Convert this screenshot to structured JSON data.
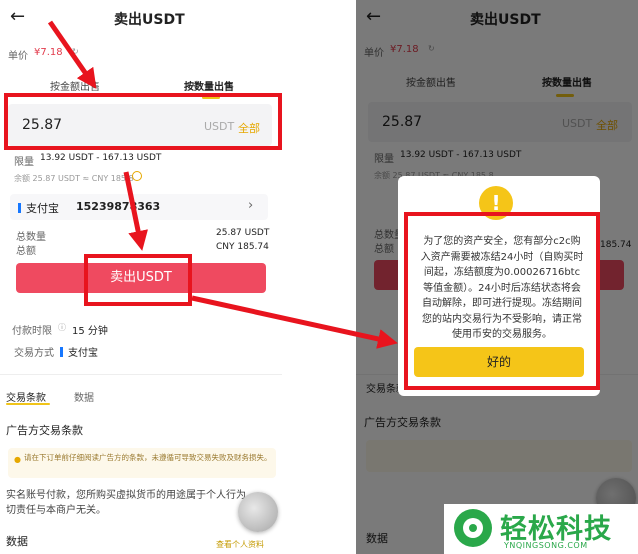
{
  "left": {
    "header": {
      "back": "←",
      "title": "卖出USDT"
    },
    "price": {
      "label": "单价",
      "value": "¥7.18"
    },
    "tabs": [
      {
        "label": "按金额出售"
      },
      {
        "label": "按数量出售"
      }
    ],
    "amount": {
      "value": "25.87",
      "unit": "USDT",
      "all": "全部"
    },
    "limit": {
      "label": "限量",
      "value": "13.92 USDT - 167.13 USDT"
    },
    "balance": {
      "text": "余额 25.87 USDT ≈ CNY 185.8"
    },
    "payment": {
      "label": "支付宝",
      "account": "15239878363"
    },
    "total_qty": {
      "label": "总数量",
      "value": "25.87 USDT"
    },
    "total_amt": {
      "label": "总额",
      "value": "CNY 185.74"
    },
    "sell_button": "卖出USDT",
    "pay_time": {
      "label": "付款时限",
      "value": "15 分钟"
    },
    "pay_method": {
      "label": "交易方式",
      "value": "支付宝"
    },
    "section_tabs": [
      {
        "label": "交易条款"
      },
      {
        "label": "数据"
      }
    ],
    "ad_terms_title": "广告方交易条款",
    "notice": "请在下订单前仔细阅读广告方的条款，未遵循可导致交易失败及财务损失。",
    "realname_text": "实名账号付款，您所购买虚拟货币的用途属于个人行为，一切责任与本商户无关。",
    "bottom_title": "数据",
    "view_profile": "查看个人资料"
  },
  "right": {
    "header": {
      "back": "←",
      "title": "卖出USDT"
    },
    "price": {
      "label": "单价",
      "value": "¥7.18"
    },
    "tabs": [
      {
        "label": "按金额出售"
      },
      {
        "label": "按数量出售"
      }
    ],
    "amount": {
      "value": "25.87",
      "unit": "USDT",
      "all": "全部"
    },
    "limit": {
      "label": "限量",
      "value": "13.92 USDT - 167.13 USDT"
    },
    "balance": {
      "text": "余额 25.87 USDT ≈ CNY 185.8"
    },
    "total_qty": {
      "label": "总数量"
    },
    "total_amt": {
      "label": "总额",
      "value": "185.74"
    },
    "section_tab": "交易条款",
    "ad_terms_title": "广告方交易条款",
    "bottom_title": "数据"
  },
  "modal": {
    "icon": "!",
    "message": "为了您的资产安全，您有部分c2c购入资产需要被冻结24小时（自购买时间起，冻结额度为0.00026716btc等值金额）。24小时后冻结状态将会自动解除，即可进行提现。冻结期间您的站内交易行为不受影响，请正常使用币安的交易服务。",
    "ok_button": "好的"
  },
  "watermark": {
    "title": "轻松科技",
    "url": "YNQINGSONG.COM"
  },
  "colors": {
    "annotation_red": "#e8141e",
    "sell_button": "#ef4a60",
    "gold": "#f5c518",
    "watermark_green": "#2aa84a"
  }
}
